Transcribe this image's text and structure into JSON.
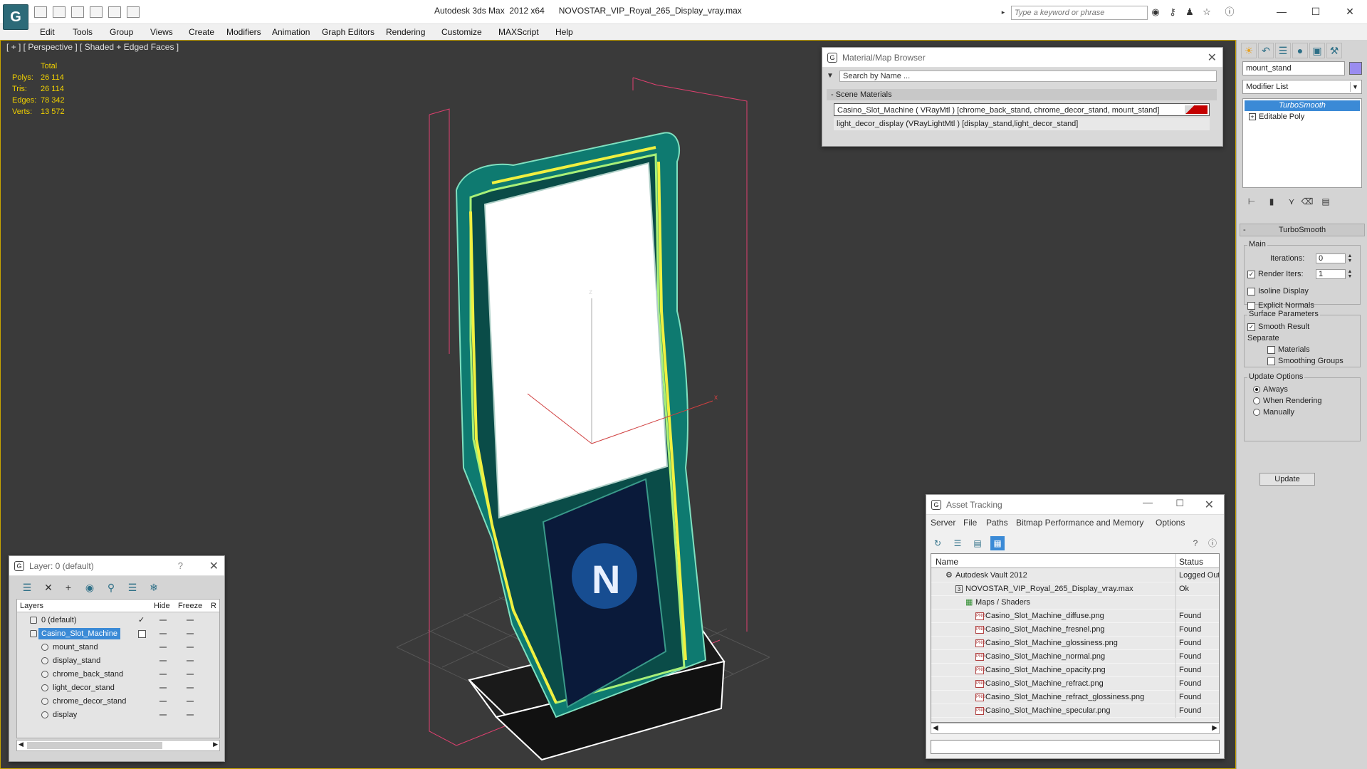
{
  "app": {
    "title": "Autodesk 3ds Max  2012 x64      NOVOSTAR_VIP_Royal_265_Display_vray.max",
    "search_placeholder": "Type a keyword or phrase",
    "logo_letter": "G"
  },
  "menu": [
    "Edit",
    "Tools",
    "Group",
    "Views",
    "Create",
    "Modifiers",
    "Animation",
    "Graph Editors",
    "Rendering",
    "Customize",
    "MAXScript",
    "Help"
  ],
  "viewport": {
    "label": "[ + ] [ Perspective ] [ Shaded + Edged Faces ]",
    "stats_header": "Total",
    "stats": [
      {
        "k": "Polys:",
        "v": "26 114"
      },
      {
        "k": "Tris:",
        "v": "26 114"
      },
      {
        "k": "Edges:",
        "v": "78 342"
      },
      {
        "k": "Verts:",
        "v": "13 572"
      }
    ],
    "axis_z": "z",
    "axis_x": "x"
  },
  "material_browser": {
    "title": "Material/Map Browser",
    "search": "Search by Name ...",
    "section": "- Scene Materials",
    "rows": [
      "Casino_Slot_Machine  ( VRayMtl ) [chrome_back_stand, chrome_decor_stand, mount_stand]",
      "light_decor_display (VRayLightMtl ) [display_stand,light_decor_stand]"
    ]
  },
  "command_panel": {
    "object_name": "mount_stand",
    "modifier_list": "Modifier List",
    "stack": [
      "TurboSmooth",
      "Editable Poly"
    ],
    "rollout_title": "TurboSmooth",
    "main_label": "Main",
    "iterations_label": "Iterations:",
    "iterations_value": "0",
    "render_iters_label": "Render Iters:",
    "render_iters_value": "1",
    "isoline": "Isoline Display",
    "explicit_normals": "Explicit Normals",
    "surface_params": "Surface Parameters",
    "smooth_result": "Smooth Result",
    "separate": "Separate",
    "materials": "Materials",
    "smoothing_groups": "Smoothing Groups",
    "update_options": "Update Options",
    "always": "Always",
    "when_rendering": "When Rendering",
    "manually": "Manually",
    "update_button": "Update"
  },
  "layer_dialog": {
    "title": "Layer: 0 (default)",
    "help": "?",
    "col_layers": "Layers",
    "col_hide": "Hide",
    "col_freeze": "Freeze",
    "col_r": "R",
    "rows": [
      {
        "name": "0 (default)",
        "indent": 0
      },
      {
        "name": "Casino_Slot_Machine",
        "indent": 0
      },
      {
        "name": "mount_stand",
        "indent": 1
      },
      {
        "name": "display_stand",
        "indent": 1
      },
      {
        "name": "chrome_back_stand",
        "indent": 1
      },
      {
        "name": "light_decor_stand",
        "indent": 1
      },
      {
        "name": "chrome_decor_stand",
        "indent": 1
      },
      {
        "name": "display",
        "indent": 1
      }
    ]
  },
  "asset_tracking": {
    "title": "Asset Tracking",
    "menus": [
      "Server",
      "File",
      "Paths",
      "Bitmap Performance and Memory",
      "Options"
    ],
    "col_name": "Name",
    "col_status": "Status",
    "rows": [
      {
        "name": "Autodesk Vault 2012",
        "status": "Logged Out",
        "level": 0
      },
      {
        "name": "NOVOSTAR_VIP_Royal_265_Display_vray.max",
        "status": "Ok",
        "level": 1
      },
      {
        "name": "Maps / Shaders",
        "status": "",
        "level": 2
      },
      {
        "name": "Casino_Slot_Machine_diffuse.png",
        "status": "Found",
        "level": 3
      },
      {
        "name": "Casino_Slot_Machine_fresnel.png",
        "status": "Found",
        "level": 3
      },
      {
        "name": "Casino_Slot_Machine_glossiness.png",
        "status": "Found",
        "level": 3
      },
      {
        "name": "Casino_Slot_Machine_normal.png",
        "status": "Found",
        "level": 3
      },
      {
        "name": "Casino_Slot_Machine_opacity.png",
        "status": "Found",
        "level": 3
      },
      {
        "name": "Casino_Slot_Machine_refract.png",
        "status": "Found",
        "level": 3
      },
      {
        "name": "Casino_Slot_Machine_refract_glossiness.png",
        "status": "Found",
        "level": 3
      },
      {
        "name": "Casino_Slot_Machine_specular.png",
        "status": "Found",
        "level": 3
      }
    ]
  }
}
